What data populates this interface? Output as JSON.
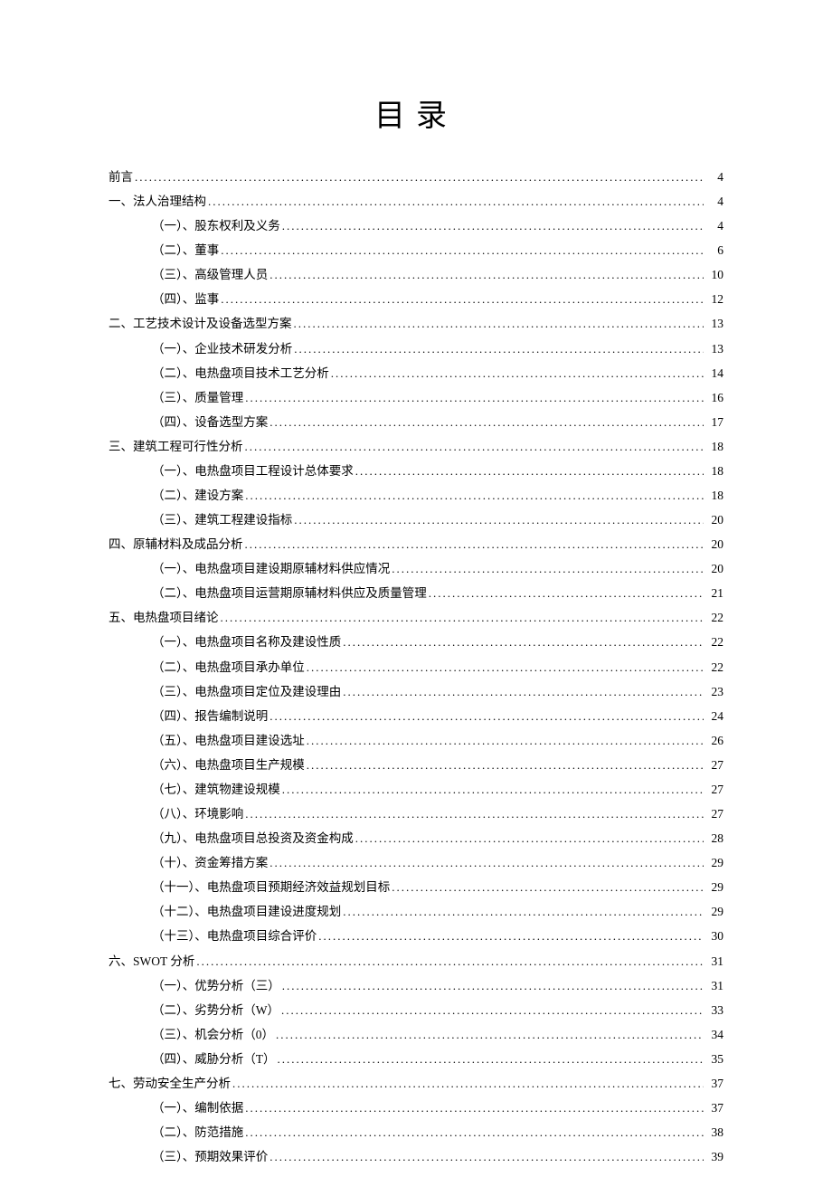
{
  "title": "目录",
  "toc": [
    {
      "level": 0,
      "label": "前言",
      "page": "4"
    },
    {
      "level": 0,
      "label": "一、法人治理结构",
      "page": "4"
    },
    {
      "level": 1,
      "label": "（一）、股东权利及义务",
      "page": "4"
    },
    {
      "level": 1,
      "label": "（二）、董事",
      "page": "6"
    },
    {
      "level": 1,
      "label": "（三）、高级管理人员",
      "page": "10"
    },
    {
      "level": 1,
      "label": "（四）、监事",
      "page": "12"
    },
    {
      "level": 0,
      "label": "二、工艺技术设计及设备选型方案",
      "page": "13"
    },
    {
      "level": 1,
      "label": "（一）、企业技术研发分析",
      "page": "13"
    },
    {
      "level": 1,
      "label": "（二）、电热盘项目技术工艺分析",
      "page": "14"
    },
    {
      "level": 1,
      "label": "（三）、质量管理",
      "page": "16"
    },
    {
      "level": 1,
      "label": "（四）、设备选型方案",
      "page": "17"
    },
    {
      "level": 0,
      "label": "三、建筑工程可行性分析",
      "page": "18"
    },
    {
      "level": 1,
      "label": "（一）、电热盘项目工程设计总体要求",
      "page": "18"
    },
    {
      "level": 1,
      "label": "（二）、建设方案",
      "page": "18"
    },
    {
      "level": 1,
      "label": "（三）、建筑工程建设指标",
      "page": "20"
    },
    {
      "level": 0,
      "label": "四、原辅材料及成品分析",
      "page": "20"
    },
    {
      "level": 1,
      "label": "（一）、电热盘项目建设期原辅材料供应情况",
      "page": "20"
    },
    {
      "level": 1,
      "label": "（二）、电热盘项目运营期原辅材料供应及质量管理",
      "page": "21"
    },
    {
      "level": 0,
      "label": "五、电热盘项目绪论",
      "page": "22"
    },
    {
      "level": 1,
      "label": "（一）、电热盘项目名称及建设性质",
      "page": "22"
    },
    {
      "level": 1,
      "label": "（二）、电热盘项目承办单位",
      "page": "22"
    },
    {
      "level": 1,
      "label": "（三）、电热盘项目定位及建设理由",
      "page": "23"
    },
    {
      "level": 1,
      "label": "（四）、报告编制说明",
      "page": "24"
    },
    {
      "level": 1,
      "label": "（五）、电热盘项目建设选址",
      "page": "26"
    },
    {
      "level": 1,
      "label": "（六）、电热盘项目生产规模",
      "page": "27"
    },
    {
      "level": 1,
      "label": "（七）、建筑物建设规模",
      "page": "27"
    },
    {
      "level": 1,
      "label": "（八）、环境影响",
      "page": "27"
    },
    {
      "level": 1,
      "label": "（九）、电热盘项目总投资及资金构成",
      "page": "28"
    },
    {
      "level": 1,
      "label": "（十）、资金筹措方案",
      "page": "29"
    },
    {
      "level": 1,
      "label": "（十一）、电热盘项目预期经济效益规划目标",
      "page": "29"
    },
    {
      "level": 1,
      "label": "（十二）、电热盘项目建设进度规划",
      "page": "29"
    },
    {
      "level": 1,
      "label": "（十三）、电热盘项目综合评价",
      "page": "30"
    },
    {
      "level": 0,
      "label": "六、SWOT 分析",
      "page": "31"
    },
    {
      "level": 1,
      "label": "（一）、优势分析（三）",
      "page": "31"
    },
    {
      "level": 1,
      "label": "（二）、劣势分析（W）",
      "page": "33"
    },
    {
      "level": 1,
      "label": "（三）、机会分析（0）",
      "page": "34"
    },
    {
      "level": 1,
      "label": "（四）、威胁分析（T）",
      "page": "35"
    },
    {
      "level": 0,
      "label": "七、劳动安全生产分析",
      "page": "37"
    },
    {
      "level": 1,
      "label": "（一）、编制依据",
      "page": "37"
    },
    {
      "level": 1,
      "label": "（二）、防范措施",
      "page": "38"
    },
    {
      "level": 1,
      "label": "（三）、预期效果评价",
      "page": "39"
    }
  ]
}
